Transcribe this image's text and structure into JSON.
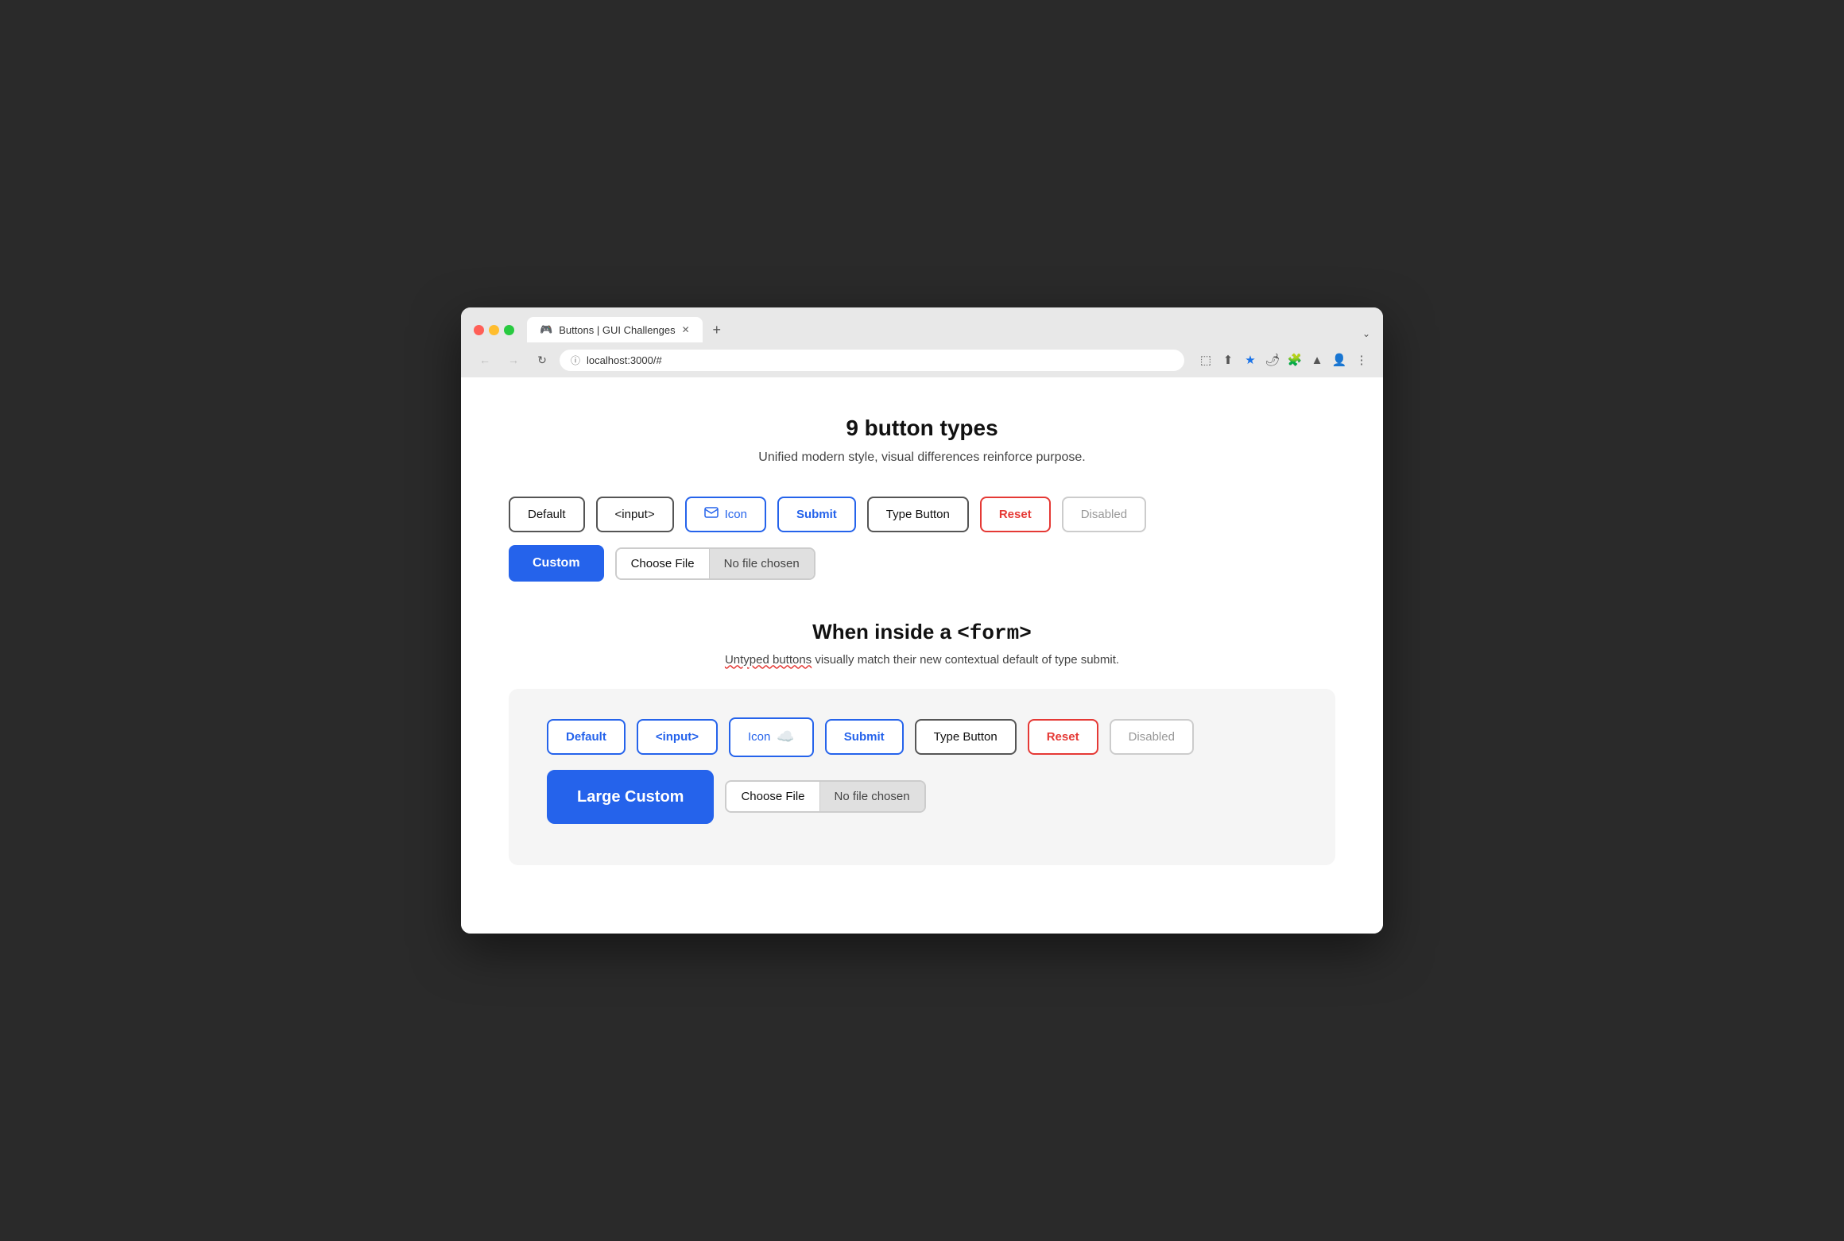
{
  "browser": {
    "tab_title": "Buttons | GUI Challenges",
    "tab_favicon": "🎮",
    "address": "localhost:3000/#",
    "new_tab_label": "+",
    "chevron_label": "⌄"
  },
  "nav": {
    "back": "←",
    "forward": "→",
    "refresh": "↻",
    "address_icon": "ⓘ"
  },
  "toolbar_icons": {
    "external": "⬚",
    "share": "⬆",
    "star": "★",
    "extension1": "🌶",
    "extension2": "🧩",
    "extension3": "▲",
    "extension4": "👤",
    "more": "⋮"
  },
  "page": {
    "title": "9 button types",
    "subtitle": "Unified modern style, visual differences reinforce purpose."
  },
  "buttons_section1": {
    "default_label": "Default",
    "input_label": "<input>",
    "icon_label": "Icon",
    "submit_label": "Submit",
    "type_button_label": "Type Button",
    "reset_label": "Reset",
    "disabled_label": "Disabled",
    "custom_label": "Custom",
    "file_choose_label": "Choose File",
    "file_no_chosen_label": "No file chosen"
  },
  "form_section": {
    "title_prefix": "When inside a ",
    "title_code": "<form>",
    "subtitle_part1": "Untyped buttons",
    "subtitle_part2": " visually match their new contextual default of type submit.",
    "default_label": "Default",
    "input_label": "<input>",
    "icon_label": "Icon",
    "submit_label": "Submit",
    "type_button_label": "Type Button",
    "reset_label": "Reset",
    "disabled_label": "Disabled",
    "large_custom_label": "Large Custom",
    "file_choose_label": "Choose File",
    "file_no_chosen_label": "No file chosen"
  }
}
